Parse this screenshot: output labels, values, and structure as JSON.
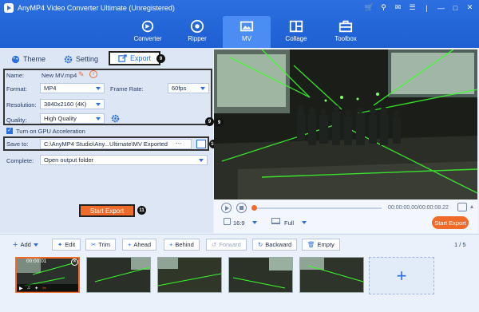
{
  "app": {
    "title": "AnyMP4 Video Converter Ultimate (Unregistered)"
  },
  "nav": {
    "tabs": [
      {
        "label": "Converter"
      },
      {
        "label": "Ripper"
      },
      {
        "label": "MV"
      },
      {
        "label": "Collage"
      },
      {
        "label": "Toolbox"
      }
    ]
  },
  "subtabs": {
    "theme": "Theme",
    "setting": "Setting",
    "export": "Export"
  },
  "markers": {
    "export": "9",
    "settings": "9",
    "save": "10",
    "start": "11"
  },
  "export": {
    "name_label": "Name:",
    "name_value": "New MV.mp4",
    "format_label": "Format:",
    "format_value": "MP4",
    "framerate_label": "Frame Rate:",
    "framerate_value": "60fps",
    "resolution_label": "Resolution:",
    "resolution_value": "3840x2160 (4K)",
    "quality_label": "Quality:",
    "quality_value": "High Quality",
    "gpu_label": "Turn on GPU Acceleration",
    "gpu_checked": true,
    "saveto_label": "Save to:",
    "saveto_value": "C:\\AnyMP4 Studio\\Any...Ultimate\\MV Exported",
    "saveto_more": "···",
    "complete_label": "Complete:",
    "complete_value": "Open output folder",
    "start_button": "Start Export"
  },
  "player": {
    "time": "00:00:00.00/00:00:08.22",
    "aspect": "16:9",
    "view": "Full",
    "progress": 0,
    "start_button": "Start Export"
  },
  "toolbar": {
    "add": "Add",
    "edit": "Edit",
    "trim": "Trim",
    "ahead": "Ahead",
    "behind": "Behind",
    "forward": "Forward",
    "backward": "Backward",
    "empty": "Empty",
    "page": "1 / 5"
  },
  "thumbs": {
    "first_time": "00:00:01"
  },
  "colors": {
    "accent": "#2b6fe0",
    "orange": "#f06a2a",
    "laser": "#39ff2a"
  }
}
